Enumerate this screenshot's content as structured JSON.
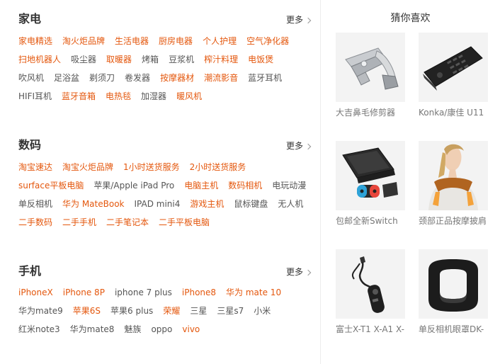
{
  "categories": [
    {
      "title": "家电",
      "more": "更多",
      "rows": [
        [
          {
            "t": "家电精选",
            "h": true
          },
          {
            "t": "淘火炬品牌",
            "h": true
          },
          {
            "t": "生活电器",
            "h": true
          },
          {
            "t": "厨房电器",
            "h": true
          },
          {
            "t": "个人护理",
            "h": true
          },
          {
            "t": "空气净化器",
            "h": true
          }
        ],
        [
          {
            "t": "扫地机器人",
            "h": true
          },
          {
            "t": "吸尘器",
            "h": false
          },
          {
            "t": "取暖器",
            "h": true
          },
          {
            "t": "烤箱",
            "h": false
          },
          {
            "t": "豆浆机",
            "h": false
          },
          {
            "t": "榨汁料理",
            "h": true
          },
          {
            "t": "电饭煲",
            "h": true
          }
        ],
        [
          {
            "t": "吹风机",
            "h": false
          },
          {
            "t": "足浴盆",
            "h": false
          },
          {
            "t": "剃须刀",
            "h": false
          },
          {
            "t": "卷发器",
            "h": false
          },
          {
            "t": "按摩器材",
            "h": true
          },
          {
            "t": "潮流影音",
            "h": true
          },
          {
            "t": "蓝牙耳机",
            "h": false
          }
        ],
        [
          {
            "t": "HIFI耳机",
            "h": false
          },
          {
            "t": "蓝牙音箱",
            "h": true
          },
          {
            "t": "电热毯",
            "h": true
          },
          {
            "t": "加湿器",
            "h": false
          },
          {
            "t": "暖风机",
            "h": true
          }
        ]
      ]
    },
    {
      "title": "数码",
      "more": "更多",
      "rows": [
        [
          {
            "t": "淘宝速达",
            "h": true
          },
          {
            "t": "淘宝火炬品牌",
            "h": true
          },
          {
            "t": "1小时送货服务",
            "h": true
          },
          {
            "t": "2小时送货服务",
            "h": true
          }
        ],
        [
          {
            "t": "surface平板电脑",
            "h": true
          },
          {
            "t": "苹果/Apple iPad Pro",
            "h": false
          },
          {
            "t": "电脑主机",
            "h": true
          },
          {
            "t": "数码相机",
            "h": true
          },
          {
            "t": "电玩动漫",
            "h": false
          }
        ],
        [
          {
            "t": "单反相机",
            "h": false
          },
          {
            "t": "华为 MateBook",
            "h": true
          },
          {
            "t": "IPAD mini4",
            "h": false
          },
          {
            "t": "游戏主机",
            "h": true
          },
          {
            "t": "鼠标键盘",
            "h": false
          },
          {
            "t": "无人机",
            "h": false
          }
        ],
        [
          {
            "t": "二手数码",
            "h": true
          },
          {
            "t": "二手手机",
            "h": true
          },
          {
            "t": "二手笔记本",
            "h": true
          },
          {
            "t": "二手平板电脑",
            "h": true
          }
        ]
      ]
    },
    {
      "title": "手机",
      "more": "更多",
      "rows": [
        [
          {
            "t": "iPhoneX",
            "h": true
          },
          {
            "t": "iPhone 8P",
            "h": true
          },
          {
            "t": "iphone 7 plus",
            "h": false
          },
          {
            "t": "iPhone8",
            "h": true
          },
          {
            "t": "华为 mate 10",
            "h": true
          }
        ],
        [
          {
            "t": "华为mate9",
            "h": false
          },
          {
            "t": "苹果6S",
            "h": true
          },
          {
            "t": "苹果6 plus",
            "h": false
          },
          {
            "t": "荣耀",
            "h": true
          },
          {
            "t": "三星",
            "h": false
          },
          {
            "t": "三星s7",
            "h": false
          },
          {
            "t": "小米",
            "h": false
          }
        ],
        [
          {
            "t": "红米note3",
            "h": false
          },
          {
            "t": "华为mate8",
            "h": false
          },
          {
            "t": "魅族",
            "h": false
          },
          {
            "t": "oppo",
            "h": false
          },
          {
            "t": "vivo",
            "h": true
          }
        ]
      ]
    }
  ],
  "recommend": {
    "title": "猜你喜欢",
    "items": [
      {
        "caption": "大吉鼻毛修剪器",
        "icon": "nose-trimmer-image"
      },
      {
        "caption": "Konka/康佳 U11",
        "icon": "flip-phone-image"
      },
      {
        "caption": "包邮全新Switch",
        "icon": "switch-console-image"
      },
      {
        "caption": "颈部正品按摩披肩",
        "icon": "neck-massager-image"
      },
      {
        "caption": "富士X-T1 X-A1 X-",
        "icon": "shutter-release-image"
      },
      {
        "caption": "单反相机眼罩DK-",
        "icon": "eyecup-image"
      }
    ]
  },
  "colors": {
    "hot": "#e4570d",
    "normal": "#555555"
  }
}
